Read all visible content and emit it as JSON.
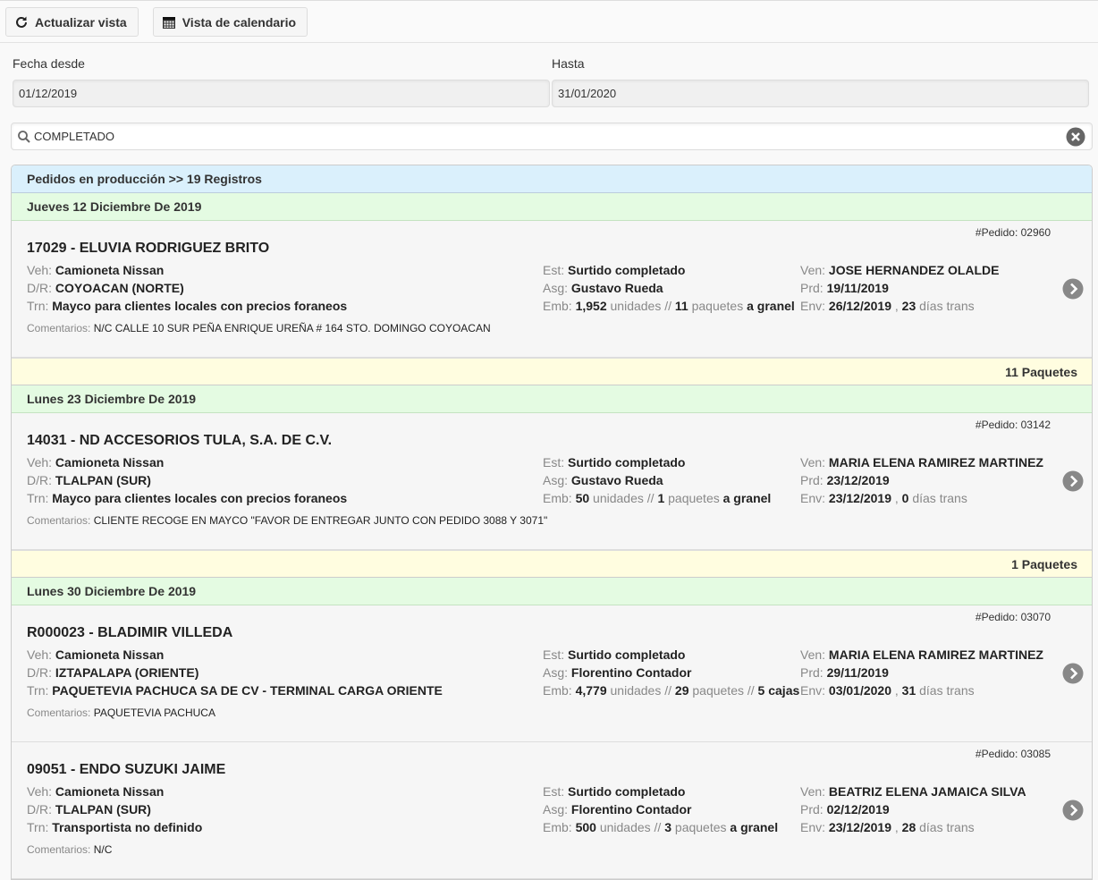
{
  "toolbar": {
    "refresh_label": "Actualizar vista",
    "calendar_label": "Vista de calendario"
  },
  "dates": {
    "from_label": "Fecha desde",
    "from_value": "01/12/2019",
    "to_label": "Hasta",
    "to_value": "31/01/2020"
  },
  "search": {
    "value": "COMPLETADO"
  },
  "list": {
    "header": "Pedidos en producción >> 19 Registros",
    "labels": {
      "veh": "Veh:",
      "dr": "D/R:",
      "trn": "Trn:",
      "est": "Est:",
      "asg": "Asg:",
      "emb": "Emb:",
      "ven": "Ven:",
      "prd": "Prd:",
      "env": "Env:",
      "comentarios": "Comentarios:",
      "order_prefix": "#Pedido:",
      "unidades": "unidades",
      "paquetes": "paquetes",
      "cajas": "cajas",
      "sep": "//",
      "dias_trans": "días trans",
      "comma": ","
    },
    "day1": "Jueves 12 Diciembre De 2019",
    "order1": {
      "num": "02960",
      "title": "17029 - ELUVIA RODRIGUEZ BRITO",
      "veh": "Camioneta Nissan",
      "dr": "COYOACAN (NORTE)",
      "trn": "Mayco para clientes locales con precios foraneos",
      "est": "Surtido completado",
      "asg": "Gustavo Rueda",
      "emb_units": "1,952",
      "emb_pkgs": "11",
      "emb_tail": "a granel",
      "ven": "JOSE HERNANDEZ OLALDE",
      "prd": "19/11/2019",
      "env": "26/12/2019",
      "dias": "23",
      "comment": "N/C CALLE 10 SUR PEÑA ENRIQUE UREÑA # 164 STO. DOMINGO COYOACAN"
    },
    "pkg1": "11 Paquetes",
    "day2": "Lunes 23 Diciembre De 2019",
    "order2": {
      "num": "03142",
      "title": "14031 - ND ACCESORIOS TULA, S.A. DE C.V.",
      "veh": "Camioneta Nissan",
      "dr": "TLALPAN (SUR)",
      "trn": "Mayco para clientes locales con precios foraneos",
      "est": "Surtido completado",
      "asg": "Gustavo Rueda",
      "emb_units": "50",
      "emb_pkgs": "1",
      "emb_tail": "a granel",
      "ven": "MARIA ELENA RAMIREZ MARTINEZ",
      "prd": "23/12/2019",
      "env": "23/12/2019",
      "dias": "0",
      "comment": "CLIENTE RECOGE EN MAYCO \"FAVOR DE ENTREGAR JUNTO CON PEDIDO 3088 Y 3071\""
    },
    "pkg2": "1 Paquetes",
    "day3": "Lunes 30 Diciembre De 2019",
    "order3": {
      "num": "03070",
      "title": "R000023 - BLADIMIR VILLEDA",
      "veh": "Camioneta Nissan",
      "dr": "IZTAPALAPA (ORIENTE)",
      "trn": "PAQUETEVIA PACHUCA SA DE CV - TERMINAL CARGA ORIENTE",
      "est": "Surtido completado",
      "asg": "Florentino Contador",
      "emb_units": "4,779",
      "emb_pkgs": "29",
      "emb_boxes": "5",
      "ven": "MARIA ELENA RAMIREZ MARTINEZ",
      "prd": "29/11/2019",
      "env": "03/01/2020",
      "dias": "31",
      "comment": "PAQUETEVIA PACHUCA"
    },
    "order4": {
      "num": "03085",
      "title": "09051 - ENDO SUZUKI JAIME",
      "veh": "Camioneta Nissan",
      "dr": "TLALPAN (SUR)",
      "trn": "Transportista no definido",
      "est": "Surtido completado",
      "asg": "Florentino Contador",
      "emb_units": "500",
      "emb_pkgs": "3",
      "emb_tail": "a granel",
      "ven": "BEATRIZ ELENA JAMAICA SILVA",
      "prd": "02/12/2019",
      "env": "23/12/2019",
      "dias": "28",
      "comment": "N/C"
    }
  }
}
